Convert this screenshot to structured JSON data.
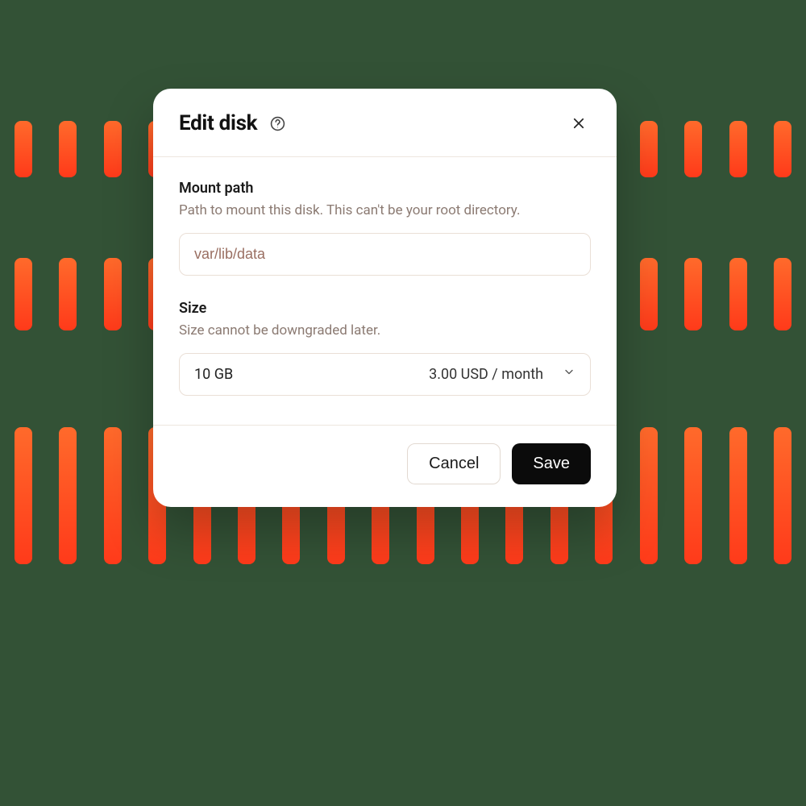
{
  "modal": {
    "title": "Edit disk",
    "fields": {
      "mount_path": {
        "label": "Mount path",
        "hint": "Path to mount this disk. This can't be your root directory.",
        "value": "var/lib/data"
      },
      "size": {
        "label": "Size",
        "hint": "Size cannot be downgraded later.",
        "selected_size": "10 GB",
        "selected_price": "3.00 USD / month"
      }
    },
    "buttons": {
      "cancel": "Cancel",
      "save": "Save"
    }
  }
}
